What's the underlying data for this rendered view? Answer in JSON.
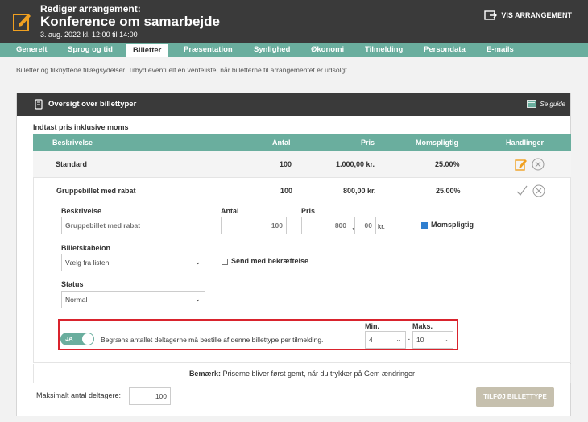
{
  "header": {
    "subtitle": "Rediger arrangement:",
    "title": "Konference om samarbejde",
    "date": "3. aug. 2022 kl. 12:00 til 14:00",
    "view_button": "VIS ARRANGEMENT"
  },
  "tabs": [
    "Generelt",
    "Sprog og tid",
    "Billetter",
    "Præsentation",
    "Synlighed",
    "Økonomi",
    "Tilmelding",
    "Persondata",
    "E-mails"
  ],
  "active_tab": "Billetter",
  "intro": "Billetter og tilknyttede tillægsydelser. Tilbyd eventuelt en venteliste, når billetterne til arrangementet er udsolgt.",
  "panel": {
    "title": "Oversigt over billettyper",
    "guide": "Se guide",
    "section_label": "Indtast pris inklusive moms"
  },
  "table": {
    "headers": [
      "Beskrivelse",
      "Antal",
      "Pris",
      "Momspligtig",
      "Handlinger"
    ],
    "rows": [
      {
        "name": "Standard",
        "count": "100",
        "price": "1.000,00 kr.",
        "vat": "25.00%"
      },
      {
        "name": "Gruppebillet med rabat",
        "count": "100",
        "price": "800,00 kr.",
        "vat": "25.00%"
      }
    ]
  },
  "form": {
    "description_label": "Beskrivelse",
    "description_value": "Gruppebillet med rabat",
    "count_label": "Antal",
    "count_value": "100",
    "price_label": "Pris",
    "price_main": "800",
    "price_sep": ",",
    "price_cents": "00",
    "price_unit": "kr.",
    "vat_label": "Momspligtig",
    "template_label": "Billetskabelon",
    "template_value": "Vælg fra listen",
    "send_label": "Send med bekræftelse",
    "status_label": "Status",
    "status_value": "Normal",
    "toggle_text": "JA",
    "limit_text": "Begræns antallet deltagerne må bestille af denne billettype per tilmelding.",
    "min_label": "Min.",
    "min_value": "4",
    "range_sep": "-",
    "max_label": "Maks.",
    "max_value": "10"
  },
  "note": {
    "bold": "Bemærk:",
    "text": "Priserne bliver først gemt, når du trykker på Gem ændringer"
  },
  "footer": {
    "max_participants_label": "Maksimalt antal deltagere:",
    "max_participants_value": "100",
    "add_button": "TILFØJ BILLETTYPE"
  },
  "colors": {
    "accent": "#6aae9e",
    "dark": "#3a3a3a",
    "highlight": "#d9232d",
    "edit_icon": "#f0a020"
  }
}
